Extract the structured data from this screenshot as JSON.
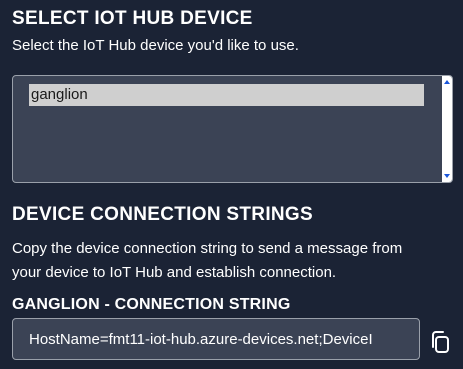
{
  "select_section": {
    "title": "SELECT IOT HUB DEVICE",
    "description": "Select the IoT Hub device you'd like to use.",
    "devices": [
      "ganglion"
    ],
    "selected_device": "ganglion"
  },
  "connection_section": {
    "title": "DEVICE CONNECTION STRINGS",
    "description_line1": "Copy the device connection string to send a message from",
    "description_line2": "your device to IoT Hub and establish connection.",
    "field_label": "GANGLION - CONNECTION STRING",
    "connection_string_value": "HostName=fmt11-iot-hub.azure-devices.net;DeviceI"
  },
  "icons": {
    "copy": "copy-icon"
  },
  "colors": {
    "background": "#1b2335",
    "field_background": "#3b4355",
    "selected_option": "#cfcfcf",
    "scroll_arrow": "#1a56db"
  }
}
